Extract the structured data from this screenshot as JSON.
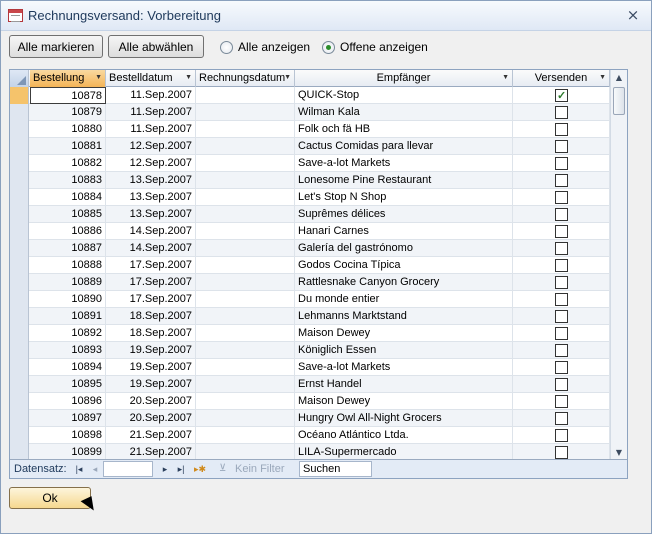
{
  "window": {
    "title": "Rechnungsversand: Vorbereitung",
    "close_label": "×"
  },
  "toolbar": {
    "mark_all": "Alle markieren",
    "unmark_all": "Alle abwählen",
    "show_all": "Alle anzeigen",
    "show_open": "Offene anzeigen",
    "selected_radio": "show_open"
  },
  "table": {
    "columns": [
      "Bestellung",
      "Bestelldatum",
      "Rechnungsdatum",
      "Empfänger",
      "Versenden"
    ],
    "rows": [
      {
        "id": "10878",
        "date": "11.Sep.2007",
        "invoice": "",
        "recipient": "QUICK-Stop",
        "send": true
      },
      {
        "id": "10879",
        "date": "11.Sep.2007",
        "invoice": "",
        "recipient": "Wilman Kala",
        "send": false
      },
      {
        "id": "10880",
        "date": "11.Sep.2007",
        "invoice": "",
        "recipient": "Folk och fä HB",
        "send": false
      },
      {
        "id": "10881",
        "date": "12.Sep.2007",
        "invoice": "",
        "recipient": "Cactus Comidas para llevar",
        "send": false
      },
      {
        "id": "10882",
        "date": "12.Sep.2007",
        "invoice": "",
        "recipient": "Save-a-lot Markets",
        "send": false
      },
      {
        "id": "10883",
        "date": "13.Sep.2007",
        "invoice": "",
        "recipient": "Lonesome Pine Restaurant",
        "send": false
      },
      {
        "id": "10884",
        "date": "13.Sep.2007",
        "invoice": "",
        "recipient": "Let's Stop N Shop",
        "send": false
      },
      {
        "id": "10885",
        "date": "13.Sep.2007",
        "invoice": "",
        "recipient": "Suprêmes délices",
        "send": false
      },
      {
        "id": "10886",
        "date": "14.Sep.2007",
        "invoice": "",
        "recipient": "Hanari Carnes",
        "send": false
      },
      {
        "id": "10887",
        "date": "14.Sep.2007",
        "invoice": "",
        "recipient": "Galería del gastrónomo",
        "send": false
      },
      {
        "id": "10888",
        "date": "17.Sep.2007",
        "invoice": "",
        "recipient": "Godos Cocina Típica",
        "send": false
      },
      {
        "id": "10889",
        "date": "17.Sep.2007",
        "invoice": "",
        "recipient": "Rattlesnake Canyon Grocery",
        "send": false
      },
      {
        "id": "10890",
        "date": "17.Sep.2007",
        "invoice": "",
        "recipient": "Du monde entier",
        "send": false
      },
      {
        "id": "10891",
        "date": "18.Sep.2007",
        "invoice": "",
        "recipient": "Lehmanns Marktstand",
        "send": false
      },
      {
        "id": "10892",
        "date": "18.Sep.2007",
        "invoice": "",
        "recipient": "Maison Dewey",
        "send": false
      },
      {
        "id": "10893",
        "date": "19.Sep.2007",
        "invoice": "",
        "recipient": "Königlich Essen",
        "send": false
      },
      {
        "id": "10894",
        "date": "19.Sep.2007",
        "invoice": "",
        "recipient": "Save-a-lot Markets",
        "send": false
      },
      {
        "id": "10895",
        "date": "19.Sep.2007",
        "invoice": "",
        "recipient": "Ernst Handel",
        "send": false
      },
      {
        "id": "10896",
        "date": "20.Sep.2007",
        "invoice": "",
        "recipient": "Maison Dewey",
        "send": false
      },
      {
        "id": "10897",
        "date": "20.Sep.2007",
        "invoice": "",
        "recipient": "Hungry Owl All-Night Grocers",
        "send": false
      },
      {
        "id": "10898",
        "date": "21.Sep.2007",
        "invoice": "",
        "recipient": "Océano Atlántico Ltda.",
        "send": false
      },
      {
        "id": "10899",
        "date": "21.Sep.2007",
        "invoice": "",
        "recipient": "LILA-Supermercado",
        "send": false
      }
    ]
  },
  "navigation": {
    "label": "Datensatz:",
    "filter_label": "Kein Filter",
    "search_placeholder": "Suchen"
  },
  "footer": {
    "ok_label": "Ok"
  },
  "icons": {
    "first": "first-record-icon",
    "prev": "prev-record-icon",
    "next": "next-record-icon",
    "last": "last-record-icon",
    "new": "new-record-icon",
    "filter": "filter-icon"
  }
}
